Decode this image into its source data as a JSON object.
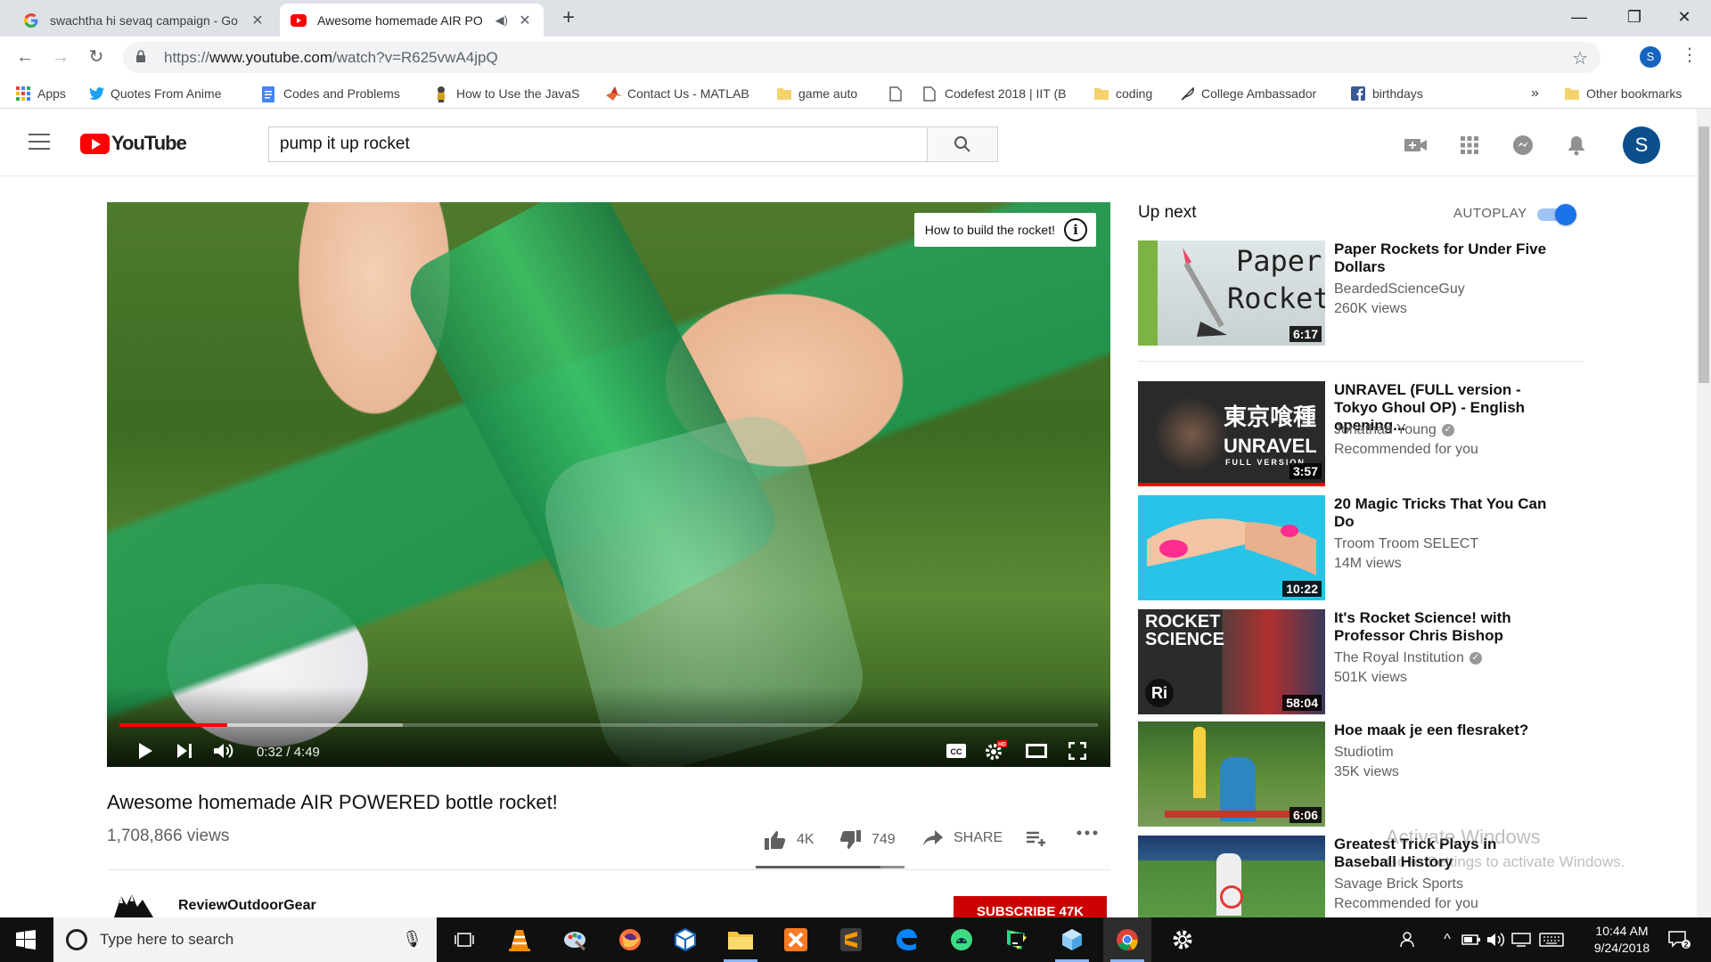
{
  "browser": {
    "tabs": [
      {
        "title": "swachtha hi sevaq campaign - Go",
        "icon": "google-icon",
        "active": false
      },
      {
        "title": "Awesome homemade AIR PO",
        "icon": "youtube-icon",
        "active": true
      }
    ],
    "url_prefix": "https://",
    "url_host": "www.youtube.com",
    "url_path": "/watch?v=R625vwA4jpQ",
    "profile_initial": "S",
    "bookmarks": [
      {
        "label": "Apps",
        "icon": "apps-grid-icon"
      },
      {
        "label": "Quotes From Anime",
        "icon": "twitter-icon"
      },
      {
        "label": "Codes and Problems",
        "icon": "docs-icon"
      },
      {
        "label": "How to Use the JavaS",
        "icon": "java-icon"
      },
      {
        "label": "Contact Us - MATLAB",
        "icon": "matlab-icon"
      },
      {
        "label": "game auto",
        "icon": "folder-icon"
      },
      {
        "label": "",
        "icon": "page-icon"
      },
      {
        "label": "Codefest 2018 | IIT (B",
        "icon": "page-icon"
      },
      {
        "label": "coding",
        "icon": "folder-icon"
      },
      {
        "label": "College Ambassador",
        "icon": "feather-icon"
      },
      {
        "label": "birthdays",
        "icon": "facebook-icon"
      }
    ],
    "bookmarks_overflow": "»",
    "other_bookmarks": "Other bookmarks"
  },
  "youtube": {
    "logo_text": "YouTube",
    "search_query": "pump it up rocket",
    "avatar_initial": "S"
  },
  "player": {
    "card_text": "How to build the rocket!",
    "card_info": "i",
    "current_time": "0:32",
    "duration": "4:49",
    "time_display": "0:32 / 4:49",
    "played_fraction": 0.11,
    "loaded_fraction": 0.29
  },
  "video": {
    "title": "Awesome homemade AIR POWERED bottle rocket!",
    "views": "1,708,866 views",
    "likes": "4K",
    "dislikes": "749",
    "share_label": "SHARE",
    "like_ratio": 0.84,
    "channel": "ReviewOutdoorGear",
    "subscribe_label": "SUBSCRIBE 47K"
  },
  "sidebar": {
    "up_next_label": "Up next",
    "autoplay_label": "AUTOPLAY",
    "autoplay_on": true,
    "recommendations": [
      {
        "title": "Paper Rockets for Under Five Dollars",
        "channel": "BeardedScienceGuy",
        "meta": "260K views",
        "duration": "6:17",
        "thumb_text_1": "Paper",
        "thumb_text_2": "Rockets",
        "verified": false
      },
      {
        "title": "UNRAVEL (FULL version - Tokyo Ghoul OP) - English opening...",
        "channel": "Jonathan Young",
        "meta": "Recommended for you",
        "duration": "3:57",
        "thumb_text_1": "東京喰種",
        "thumb_text_2": "UNRAVEL",
        "thumb_text_3": "FULL VERSION",
        "verified": true
      },
      {
        "title": "20 Magic Tricks That You Can Do",
        "channel": "Troom Troom SELECT",
        "meta": "14M views",
        "duration": "10:22",
        "verified": false
      },
      {
        "title": "It's Rocket Science! with Professor Chris Bishop",
        "channel": "The Royal Institution",
        "meta": "501K views",
        "duration": "58:04",
        "thumb_text_1": "ROCKET",
        "thumb_text_2": "SCIENCE",
        "thumb_text_3": "Ri",
        "verified": true
      },
      {
        "title": "Hoe maak je een flesraket?",
        "channel": "Studiotim",
        "meta": "35K views",
        "duration": "6:06",
        "verified": false
      },
      {
        "title": "Greatest Trick Plays in Baseball History",
        "channel": "Savage Brick Sports",
        "meta": "Recommended for you",
        "duration": "",
        "verified": false
      }
    ]
  },
  "watermark": {
    "line1": "Activate Windows",
    "line2": "Go to Settings to activate Windows."
  },
  "taskbar": {
    "search_placeholder": "Type here to search",
    "time": "10:44 AM",
    "date": "9/24/2018",
    "notification_count": "2"
  }
}
